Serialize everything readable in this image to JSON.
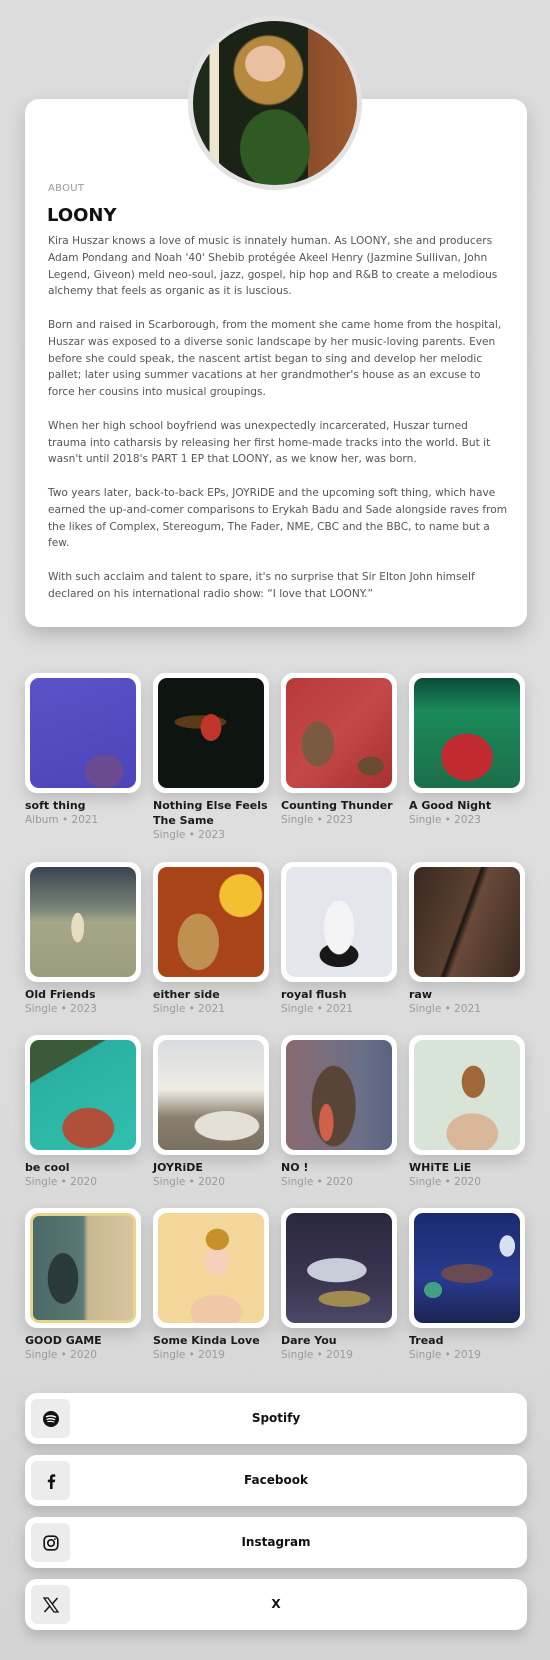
{
  "about": {
    "label": "ABOUT",
    "title": "LOONY",
    "paragraphs": [
      "Kira Huszar knows a love of music is innately human. As LOONY, she and producers Adam Pondang and Noah '40' Shebib protégée Akeel Henry (Jazmine Sullivan, John Legend, Giveon) meld neo-soul, jazz, gospel, hip hop and R&B to create a melodious alchemy that feels as organic as it is luscious.",
      "Born and raised in Scarborough, from the moment she came home from the hospital, Huszar was exposed to a diverse sonic landscape by her music-loving parents. Even before she could speak, the nascent artist began to sing and develop her melodic pallet; later using summer vacations at her grandmother's house as an excuse to force her cousins into musical groupings.",
      "When her high school boyfriend was unexpectedly incarcerated, Huszar turned trauma into catharsis by releasing her first home-made tracks into the world. But it wasn't until 2018's PART 1 EP that LOONY, as we know her, was born.",
      "Two years later, back-to-back EPs, JOYRiDE and the upcoming soft thing, which have earned the up-and-comer comparisons to Erykah Badu and Sade alongside raves from the likes of Complex, Stereogum, The Fader, NME, CBC and the BBC, to name but a few.",
      "With such acclaim and talent to spare, it's no surprise that Sir Elton John himself declared on his international radio show: “I love that LOONY.”"
    ]
  },
  "releases": [
    {
      "title": "soft thing",
      "meta": "Album • 2021"
    },
    {
      "title": "Nothing Else Feels The Same",
      "meta": "Single • 2023"
    },
    {
      "title": "Counting Thunder",
      "meta": "Single • 2023"
    },
    {
      "title": "A Good Night",
      "meta": "Single • 2023"
    },
    {
      "title": "Old Friends",
      "meta": "Single • 2023"
    },
    {
      "title": "either side",
      "meta": "Single • 2021"
    },
    {
      "title": "royal flush",
      "meta": "Single • 2021"
    },
    {
      "title": "raw",
      "meta": "Single • 2021"
    },
    {
      "title": "be cool",
      "meta": "Single • 2020"
    },
    {
      "title": "JOYRiDE",
      "meta": "Single • 2020"
    },
    {
      "title": "NO !",
      "meta": "Single • 2020"
    },
    {
      "title": "WHiTE LiE",
      "meta": "Single • 2020"
    },
    {
      "title": "GOOD GAME",
      "meta": "Single • 2020"
    },
    {
      "title": "Some Kinda Love",
      "meta": "Single • 2019"
    },
    {
      "title": "Dare You",
      "meta": "Single • 2019"
    },
    {
      "title": "Tread",
      "meta": "Single • 2019"
    }
  ],
  "links": [
    {
      "label": "Spotify",
      "icon": "spotify-icon"
    },
    {
      "label": "Facebook",
      "icon": "facebook-icon"
    },
    {
      "label": "Instagram",
      "icon": "instagram-icon"
    },
    {
      "label": "X",
      "icon": "x-icon"
    }
  ]
}
